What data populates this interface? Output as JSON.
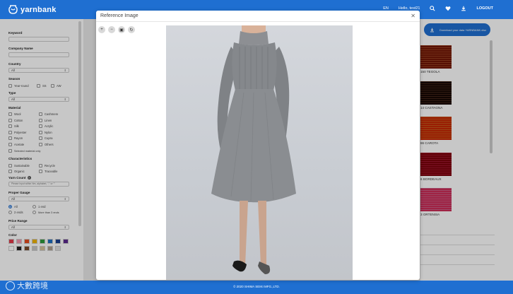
{
  "header": {
    "brand": "yarnbank",
    "lang": "EN",
    "greeting": "Hello, test21",
    "logout": "LOGOUT"
  },
  "sidebar": {
    "keyword_label": "Keyword",
    "company_label": "Company Name",
    "country_label": "Country",
    "country_value": "All",
    "season_label": "Season",
    "season_options": [
      "Year-round",
      "SS",
      "AW"
    ],
    "type_label": "Type",
    "type_value": "All",
    "material_label": "Material",
    "materials": [
      "Wool",
      "Cashmere",
      "Cotton",
      "Linen",
      "Silk",
      "Acrylic",
      "Polyester",
      "Nylon",
      "Rayon",
      "Cupra",
      "Acetate",
      "Others"
    ],
    "materials_only": "Selected material only",
    "characteristics_label": "Characteristics",
    "characteristics": [
      "Sustainable",
      "Recycle",
      "Organic",
      "Traceable"
    ],
    "yarn_count_label": "Yarn Count",
    "yarn_count_placeholder": "Please input within Nm, alphabet, \",\" or \"\"",
    "gauge_label": "Proper Gauge",
    "gauge_value": "All",
    "ends_options": [
      "All",
      "1 end",
      "2 ends",
      "More than 3 ends"
    ],
    "price_label": "Price Range",
    "price_value": "All",
    "color_label": "Color",
    "colors": [
      "#e23a4a",
      "#f29ab0",
      "#e84c1e",
      "#f0b400",
      "#2e9a3c",
      "#1c6fc2",
      "#1a3f8f",
      "#5b2a8f",
      "#ffffff",
      "#222222",
      "#7a4a2a",
      "#c8c8c8",
      "#d8c39a",
      "#b0a090",
      "#e0e0e0"
    ]
  },
  "modal": {
    "title": "Reference Image"
  },
  "content": {
    "download_label": "Download your data YARNBANK.xlsx",
    "yarns": [
      {
        "name": "150 TEGOLA",
        "color": "#a94a26"
      },
      {
        "name": "14 CASTAGNA",
        "color": "#4a2a1c"
      },
      {
        "name": "86 CAROTA",
        "color": "#e0641f"
      },
      {
        "name": "6 BORDEAUX",
        "color": "#b21a35"
      },
      {
        "name": "3 ORTENSIA",
        "color": "#e46a95"
      }
    ]
  },
  "footer": {
    "copyright": "© 2020 SHIMA SEIKI MFG.,LTD.",
    "watermark": "大數跨境"
  }
}
